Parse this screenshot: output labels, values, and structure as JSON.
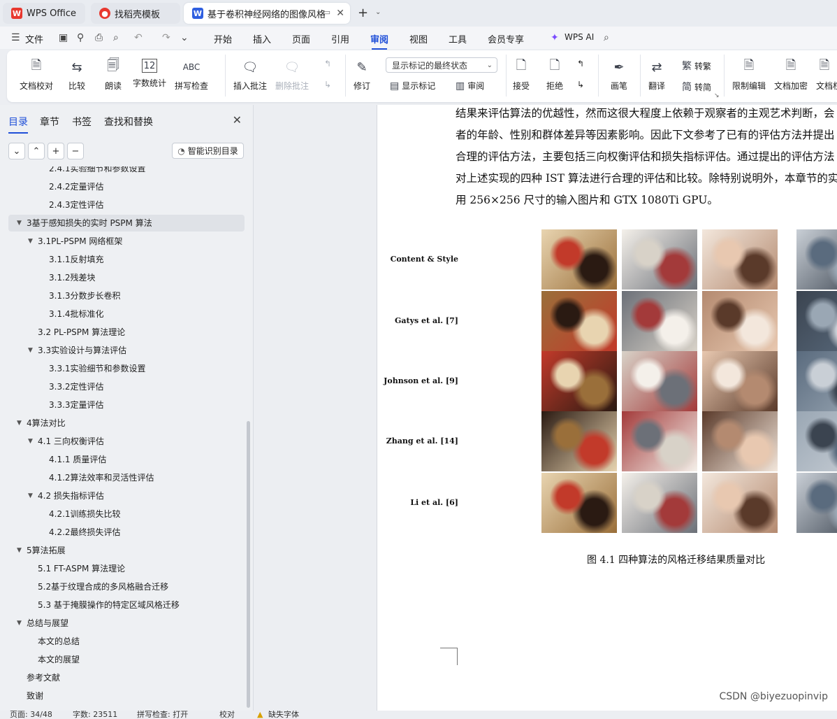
{
  "tabs": [
    {
      "label": "WPS Office"
    },
    {
      "label": "找稻壳模板"
    },
    {
      "label": "基于卷积神经网络的图像风格迁"
    }
  ],
  "menu": {
    "file": "文件",
    "items": [
      "开始",
      "插入",
      "页面",
      "引用",
      "审阅",
      "视图",
      "工具",
      "会员专享"
    ],
    "active": "审阅",
    "wps_ai": "WPS AI"
  },
  "ribbon": {
    "doc_check": "文档校对",
    "compare": "比较",
    "read_aloud": "朗读",
    "word_count": "字数统计",
    "spell_check": "拼写检查",
    "spell_icon": "ABC",
    "insert_comment": "插入批注",
    "delete_comment": "删除批注",
    "track_changes": "修订",
    "display_select": "显示标记的最终状态",
    "show_markup": "显示标记",
    "review_pane": "审阅",
    "accept": "接受",
    "reject": "拒绝",
    "pen": "画笔",
    "translate": "翻译",
    "to_traditional": "转繁",
    "to_simplified": "转简",
    "restrict_edit": "限制编辑",
    "doc_encrypt": "文档加密",
    "doc_permission": "文档权"
  },
  "sidebar": {
    "tabs": [
      "目录",
      "章节",
      "书签",
      "查找和替换"
    ],
    "active_tab": "目录",
    "smart_toc": "智能识别目录",
    "toc": [
      {
        "label": "2.4.1实验细节和参数设置",
        "level": 3
      },
      {
        "label": "2.4.2定量评估",
        "level": 3
      },
      {
        "label": "2.4.3定性评估",
        "level": 3
      },
      {
        "label": "3基于感知损失的实时 PSPM 算法",
        "level": 1,
        "expanded": true,
        "selected": true
      },
      {
        "label": "3.1PL-PSPM  网络框架",
        "level": 2,
        "expanded": true
      },
      {
        "label": "3.1.1反射填充",
        "level": 3
      },
      {
        "label": "3.1.2残差块",
        "level": 3
      },
      {
        "label": "3.1.3分数步长卷积",
        "level": 3
      },
      {
        "label": "3.1.4批标准化",
        "level": 3
      },
      {
        "label": "3.2  PL-PSPM 算法理论",
        "level": 2
      },
      {
        "label": "3.3实验设计与算法评估",
        "level": 2,
        "expanded": true
      },
      {
        "label": "3.3.1实验细节和参数设置",
        "level": 3
      },
      {
        "label": "3.3.2定性评估",
        "level": 3
      },
      {
        "label": "3.3.3定量评估",
        "level": 3
      },
      {
        "label": "4算法对比",
        "level": 1,
        "expanded": true
      },
      {
        "label": "4.1     三向权衡评估",
        "level": 2,
        "expanded": true
      },
      {
        "label": "4.1.1  质量评估",
        "level": 3
      },
      {
        "label": "4.1.2算法效率和灵活性评估",
        "level": 3
      },
      {
        "label": "4.2  损失指标评估",
        "level": 2,
        "expanded": true
      },
      {
        "label": "4.2.1训练损失比较",
        "level": 3
      },
      {
        "label": "4.2.2最终损失评估",
        "level": 3
      },
      {
        "label": "5算法拓展",
        "level": 1,
        "expanded": true
      },
      {
        "label": "5.1  FT-ASPM 算法理论",
        "level": 2
      },
      {
        "label": "5.2基于纹理合成的多风格融合迁移",
        "level": 2
      },
      {
        "label": "5.3  基于掩膜操作的特定区域风格迁移",
        "level": 2
      },
      {
        "label": "总结与展望",
        "level": 1,
        "expanded": true
      },
      {
        "label": "本文的总结",
        "level": 2
      },
      {
        "label": "本文的展望",
        "level": 2
      },
      {
        "label": "参考文献",
        "level": 1
      },
      {
        "label": "致谢",
        "level": 1
      }
    ]
  },
  "document": {
    "lines": [
      "结果来评估算法的优越性，然而这很大程度上依赖于观察者的主观艺术判断，会",
      "者的年龄、性别和群体差异等因素影响。因此下文参考了已有的评估方法并提出",
      "合理的评估方法，主要包括三向权衡评估和损失指标评估。通过提出的评估方法",
      "对上述实现的四种 IST 算法进行合理的评估和比较。除特别说明外，本章节的实",
      "用  256×256 尺寸的输入图片和 GTX 1080Ti GPU。"
    ],
    "figure_rows": [
      "Content & Style",
      "Gatys et al. [7]",
      "Johnson et al. [9]",
      "Zhang et al. [14]",
      "Li et al. [6]"
    ],
    "caption": "图 4.1  四种算法的风格迁移结果质量对比"
  },
  "watermark": "CSDN @biyezuopinvip",
  "status": {
    "page": "页面: 34/48",
    "words": "字数: 23511",
    "spell": "拼写检查: 打开",
    "proof": "校对",
    "missing_font": "缺失字体"
  },
  "colors": {
    "accent": "#1f4fd8",
    "wps_red": "#e8382f"
  }
}
